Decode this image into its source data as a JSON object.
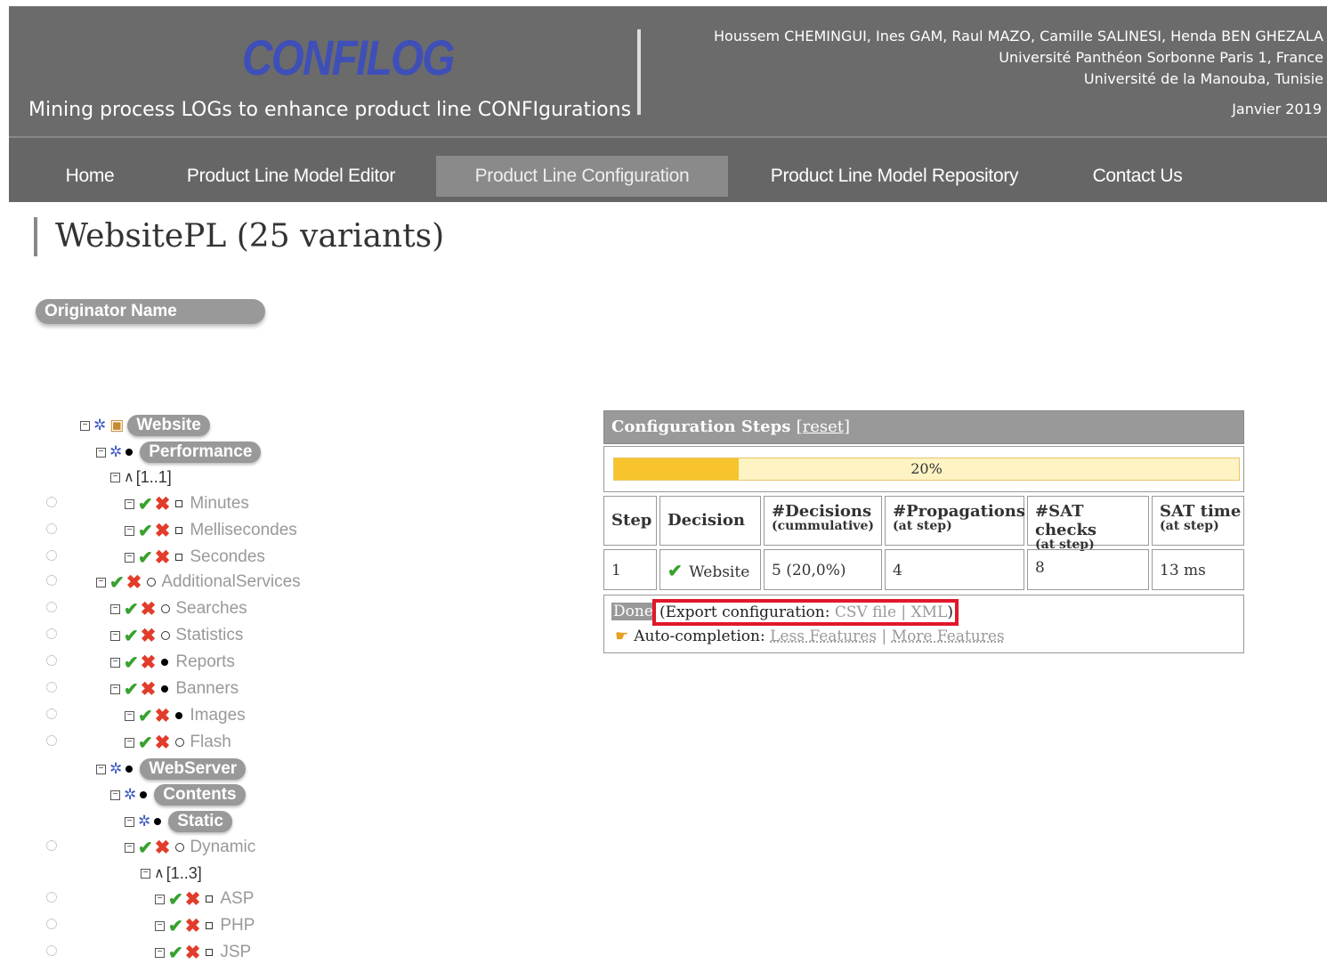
{
  "header": {
    "logo": "CONFILOG",
    "logo_sub": "Mining process LOGs to enhance product line CONFIgurations",
    "tagline": "Mining process LOGs to enhance product line CONFIgurations",
    "authors": "Houssem CHEMINGUI, Ines GAM, Raul MAZO, Camille SALINESI, Henda BEN GHEZALA",
    "affil1": "Université Panthéon Sorbonne Paris 1, France",
    "affil2": "Université de la Manouba, Tunisie",
    "date": "Janvier 2019"
  },
  "nav": [
    {
      "label": "Home"
    },
    {
      "label": "Product Line Model Editor"
    },
    {
      "label": "Product Line Configuration",
      "active": true
    },
    {
      "label": "Product Line Model Repository"
    },
    {
      "label": "Contact Us"
    }
  ],
  "page_title": "WebsitePL (25 variants)",
  "originator_label": "Originator Name",
  "tree": [
    {
      "label": "Website",
      "style": "pill"
    },
    {
      "label": "Performance",
      "style": "pill"
    },
    {
      "label": "[1..1]",
      "style": "card"
    },
    {
      "label": "Minutes",
      "style": "grey"
    },
    {
      "label": "Mellisecondes",
      "style": "grey"
    },
    {
      "label": "Secondes",
      "style": "grey"
    },
    {
      "label": "AdditionalServices",
      "style": "grey"
    },
    {
      "label": "Searches",
      "style": "grey"
    },
    {
      "label": "Statistics",
      "style": "grey"
    },
    {
      "label": "Reports",
      "style": "grey"
    },
    {
      "label": "Banners",
      "style": "grey"
    },
    {
      "label": "Images",
      "style": "grey"
    },
    {
      "label": "Flash",
      "style": "grey"
    },
    {
      "label": "WebServer",
      "style": "pill"
    },
    {
      "label": "Contents",
      "style": "pill"
    },
    {
      "label": "Static",
      "style": "pill"
    },
    {
      "label": "Dynamic",
      "style": "grey"
    },
    {
      "label": "[1..3]",
      "style": "card"
    },
    {
      "label": "ASP",
      "style": "grey"
    },
    {
      "label": "PHP",
      "style": "grey"
    },
    {
      "label": "JSP",
      "style": "grey"
    }
  ],
  "panel": {
    "title": "Configuration Steps",
    "reset": "[reset]",
    "progress": 0.2,
    "progress_label": "20%",
    "headers": [
      {
        "main": "Step",
        "sub": ""
      },
      {
        "main": "Decision",
        "sub": ""
      },
      {
        "main": "#Decisions",
        "sub": "(cummulative)"
      },
      {
        "main": "#Propagations",
        "sub": "(at step)"
      },
      {
        "main": "#SAT checks",
        "sub": "(at step)"
      },
      {
        "main": "SAT time",
        "sub": "(at step)"
      }
    ],
    "row": [
      "1",
      "Website",
      "5 (20,0%)",
      "4",
      "8",
      "13 ms"
    ],
    "done": "Done",
    "export_prefix": "(Export configuration: ",
    "csv": "CSV file",
    "sep": " | ",
    "xml": "XML",
    "export_suffix": ")",
    "auto_label": "Auto-completion: ",
    "less": "Less Features",
    "more": "More Features"
  }
}
